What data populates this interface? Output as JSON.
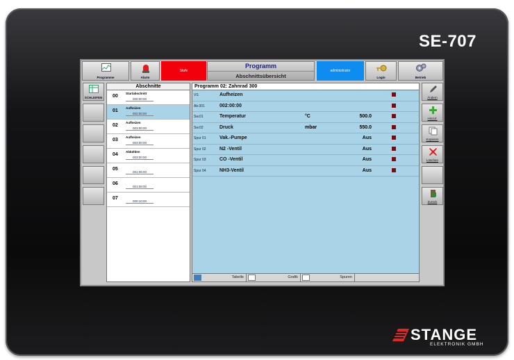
{
  "device": {
    "model": "SE-707",
    "brand": "STANGE",
    "brand_sub": "ELEKTRONIK GMBH"
  },
  "topbar": {
    "programme_label": "Programme",
    "alarm_label": "Alarm",
    "status_text": "Stufe",
    "title": "Programm",
    "subtitle": "Abschnittsübersicht",
    "user": "administrator",
    "login_label": "Login",
    "betrieb_label": "Betrieb"
  },
  "left_side": {
    "schleifen_label": "SCHLEIFEN"
  },
  "sections": {
    "header": "Abschnitte",
    "items": [
      {
        "num": "00",
        "name": "Startabschnitt",
        "time": "000:00:00"
      },
      {
        "num": "01",
        "name": "Aufheizen",
        "time": "002:00:00"
      },
      {
        "num": "02",
        "name": "Aufheizen",
        "time": "003:00:00"
      },
      {
        "num": "03",
        "name": "Aufheizen",
        "time": "003:00:00"
      },
      {
        "num": "04",
        "name": "Abkühlen",
        "time": "003:00:00"
      },
      {
        "num": "05",
        "name": "",
        "time": "001:06:00"
      },
      {
        "num": "06",
        "name": "",
        "time": "001:08:00"
      },
      {
        "num": "07",
        "name": "",
        "time": "000:10:00"
      }
    ]
  },
  "program": {
    "header": "Programm 02: Zahnrad 300",
    "rows": [
      {
        "label": "VS",
        "name": "Aufheizen",
        "unit": "",
        "value": ""
      },
      {
        "label": "Ab.001",
        "name": "002:00:00",
        "unit": "",
        "value": ""
      },
      {
        "label": "Sw.01",
        "name": "Temperatur",
        "unit": "°C",
        "value": "500.0"
      },
      {
        "label": "Sw.02",
        "name": "Druck",
        "unit": "mbar",
        "value": "550.0"
      },
      {
        "label": "Spur 01",
        "name": "Vak.-Pumpe",
        "unit": "",
        "value": "Aus"
      },
      {
        "label": "Spur 02",
        "name": "N2 -Ventil",
        "unit": "",
        "value": "Aus"
      },
      {
        "label": "Spur 03",
        "name": "CO -Ventil",
        "unit": "",
        "value": "Aus"
      },
      {
        "label": "Spur 04",
        "name": "NH3-Ventil",
        "unit": "",
        "value": "Aus"
      }
    ],
    "tabs": {
      "tabelle": "Tabelle",
      "grafik": "Grafik",
      "spuren": "Spuren"
    }
  },
  "right_side": {
    "andern": "Ändern",
    "hinzuf": "Hinzuf.",
    "kopieren": "Kopieren",
    "loschen": "Löschen",
    "zuruck": "Zurück"
  },
  "colors": {
    "alarm_red": "#f2000c",
    "user_blue": "#0e8cf0",
    "panel_blue": "#a9d3e6",
    "indicator": "#7a0c0c"
  }
}
